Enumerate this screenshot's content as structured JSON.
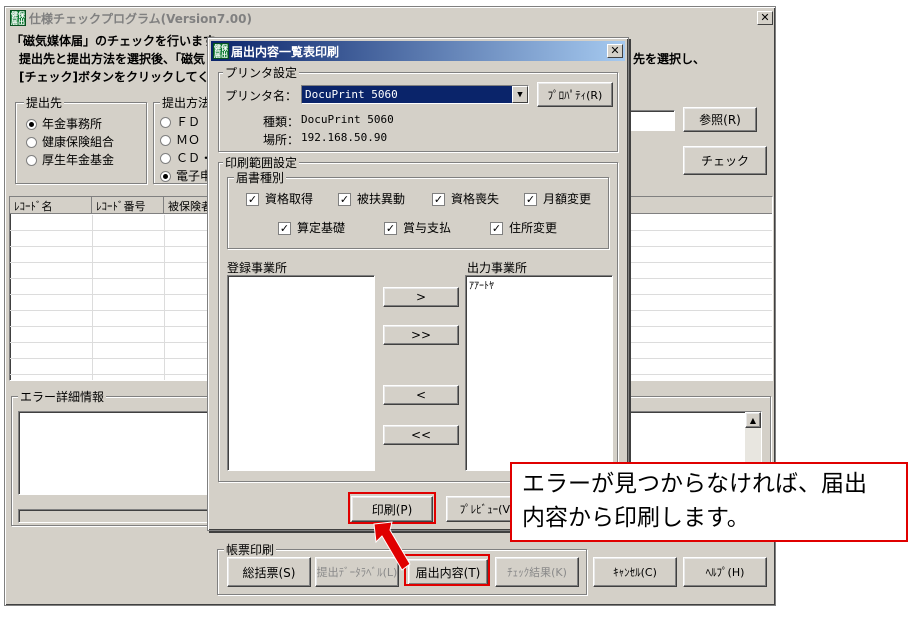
{
  "main_window": {
    "title": "仕様チェックプログラム(Version7.00)",
    "icon_text": "健保 届出",
    "close_glyph": "✕",
    "intro_line1": "「磁気媒体届」のチェックを行います",
    "intro_line2": "提出先と提出方法を選択後、「磁気",
    "intro_line2_right": "先を選択し、",
    "intro_line3": "[チェック]ボタンをクリックしてくださ",
    "submit_to": {
      "label": "提出先",
      "options": [
        "年金事務所",
        "健康保険組合",
        "厚生年金基金"
      ],
      "selected": 0
    },
    "method": {
      "label": "提出方法",
      "options": [
        "ＦＤ",
        "ＭＯ",
        "ＣＤ・",
        "電子申"
      ],
      "selected": 3
    },
    "browse_button": "参照(R)",
    "check_button": "チェック",
    "table_headers": [
      "ﾚｺｰﾄﾞ名",
      "ﾚｺｰﾄﾞ番号",
      "被保険者"
    ],
    "error_section_label": "エラー詳細情報",
    "report_print": {
      "label": "帳票印刷",
      "buttons": [
        "総括票(S)",
        "提出ﾃﾞｰﾀﾗﾍﾞﾙ(L)",
        "届出内容(T)",
        "ﾁｪｯｸ結果(K)"
      ]
    },
    "cancel_button": "ｷｬﾝｾﾙ(C)",
    "help_button": "ﾍﾙﾌﾟ(H)"
  },
  "dialog": {
    "title": "届出内容一覧表印刷",
    "close_glyph": "✕",
    "printer_settings": {
      "label": "プリンタ設定",
      "name_label": "プリンタ名：",
      "name_value": "DocuPrint 5060",
      "properties_button": "ﾌﾟﾛﾊﾟﾃｨ(R)",
      "type_label": "種類：",
      "type_value": "DocuPrint 5060",
      "location_label": "場所：",
      "location_value": "192.168.50.90"
    },
    "print_range": {
      "label": "印刷範囲設定",
      "form_types_label": "届書種別",
      "checkboxes_row1": [
        "資格取得",
        "被扶異動",
        "資格喪失",
        "月額変更"
      ],
      "checkboxes_row2": [
        "算定基礎",
        "賞与支払",
        "住所変更"
      ],
      "all_checked": true
    },
    "registered_offices_label": "登録事業所",
    "output_offices_label": "出力事業所",
    "output_offices_items": [
      "ｱｱｰﾄﾔ"
    ],
    "move_buttons": [
      ">",
      ">>",
      "<",
      "<<"
    ],
    "print_button": "印刷(P)",
    "preview_button": "ﾌﾟﾚﾋﾞｭｰ(V)"
  },
  "callout": {
    "line1": "エラーが見つからなければ、届出",
    "line2": "内容から印刷します。"
  },
  "colors": {
    "annotation_red": "#e00000",
    "selection_blue": "#0a246a"
  }
}
